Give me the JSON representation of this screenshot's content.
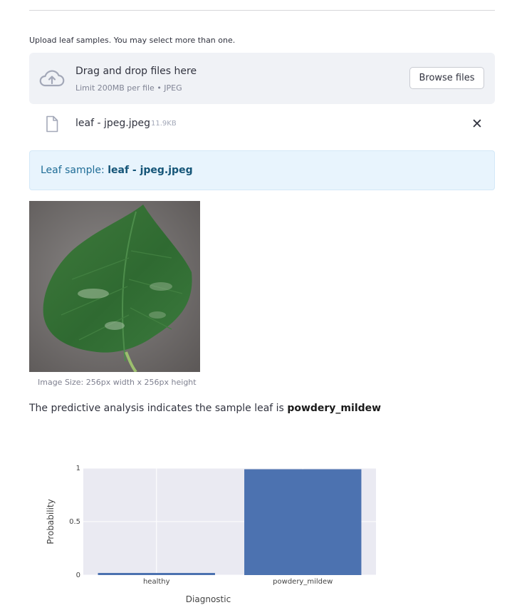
{
  "uploader": {
    "label": "Upload leaf samples. You may select more than one.",
    "drop_title": "Drag and drop files here",
    "drop_limit": "Limit 200MB per file • JPEG",
    "browse_label": "Browse files",
    "cloud_icon": "cloud-upload-icon"
  },
  "file": {
    "name": "leaf - jpeg.jpeg",
    "size": "11.9KB",
    "file_icon": "file-icon",
    "remove_symbol": "✕"
  },
  "info": {
    "prefix": "Leaf sample: ",
    "filename": "leaf - jpeg.jpeg"
  },
  "image": {
    "caption": "Image Size: 256px width x 256px height"
  },
  "prediction": {
    "text": "The predictive analysis indicates the sample leaf is ",
    "label": "powdery_mildew"
  },
  "chart_data": {
    "type": "bar",
    "categories": [
      "healthy",
      "powdery_mildew"
    ],
    "values": [
      0.02,
      0.99
    ],
    "xlabel": "Diagnostic",
    "ylabel": "Probability",
    "ylim": [
      0,
      1
    ],
    "yticks": [
      0,
      0.5,
      1
    ],
    "ytick_labels": [
      "0",
      "0.5",
      "1"
    ],
    "grid": true,
    "bar_color": "#4c72b0",
    "plot_background": "#eaeaf2"
  },
  "colors": {
    "info_background": "#e8f4fd",
    "info_text": "#1e6c96",
    "dropzone_background": "#f0f2f6"
  }
}
